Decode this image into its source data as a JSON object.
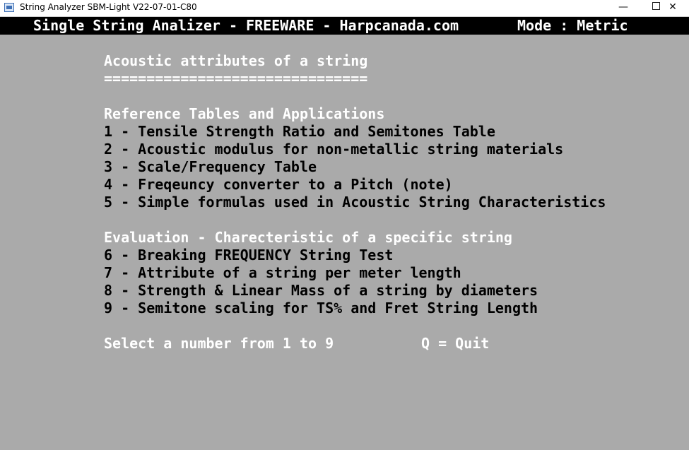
{
  "window": {
    "title": "String Analyzer SBM-Light V22-07-01-C80",
    "minimize_glyph": "—",
    "close_glyph": "✕",
    "icon": "console-app-icon"
  },
  "header": {
    "title": "Single String Analizer - FREEWARE - Harpcanada.com",
    "mode": "Mode : Metric"
  },
  "main": {
    "title": "Acoustic attributes of a string",
    "underline": "===============================",
    "sections": [
      {
        "heading": "Reference Tables and Applications",
        "items": [
          "1 - Tensile Strength Ratio and Semitones Table",
          "2 - Acoustic modulus for non-metallic string materials",
          "3 - Scale/Frequency Table",
          "4 - Freqeuncy converter to a Pitch (note)",
          "5 - Simple formulas used in Acoustic String Characteristics"
        ]
      },
      {
        "heading": "Evaluation - Charecteristic of a specific string",
        "items": [
          "6 - Breaking FREQUENCY String Test",
          "7 - Attribute of a string per meter length",
          "8 - Strength & Linear Mass of a string by diameters",
          "9 - Semitone scaling for TS% and Fret String Length"
        ]
      }
    ],
    "prompt": "Select a number from 1 to 9",
    "quit": "Q = Quit"
  },
  "colors": {
    "background": "#aaaaaa",
    "header_bg": "#000000",
    "heading_text": "#ffffff",
    "item_text": "#000000"
  }
}
